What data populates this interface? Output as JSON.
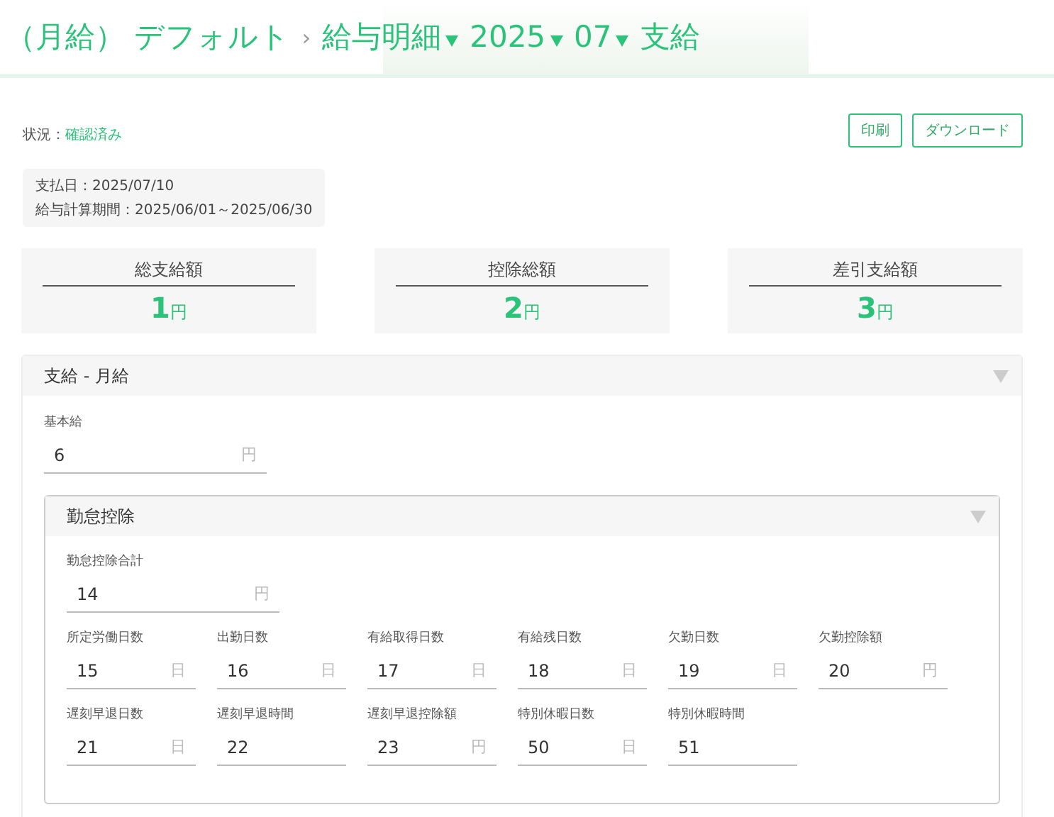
{
  "breadcrumb": [
    {
      "label": "（月給） デフォルト",
      "dropdown": false
    },
    {
      "label": "給与明細",
      "dropdown": true
    },
    {
      "label": "2025",
      "dropdown": true
    },
    {
      "label": "07",
      "dropdown": true
    },
    {
      "label": "支給",
      "dropdown": false
    }
  ],
  "breadcrumb_separator": "›",
  "status": {
    "label": "状況：",
    "value": "確認済み"
  },
  "buttons": [
    "印刷",
    "ダウンロード"
  ],
  "info": [
    "支払日：2025/07/10",
    "給与計算期間：2025/06/01～2025/06/30"
  ],
  "summary": [
    {
      "label": "総支給額",
      "amount": "1",
      "unit": "円"
    },
    {
      "label": "控除総額",
      "amount": "2",
      "unit": "円"
    },
    {
      "label": "差引支給額",
      "amount": "3",
      "unit": "円"
    }
  ],
  "panel": {
    "title": "支給 - 月給",
    "expanded": true,
    "fields": [
      {
        "label": "基本給",
        "value": "6",
        "unit": "円"
      }
    ],
    "subpanel": {
      "title": "勤怠控除",
      "expanded": true,
      "total": {
        "label": "勤怠控除合計",
        "value": "14",
        "unit": "円"
      },
      "rows": [
        [
          {
            "label": "所定労働日数",
            "value": "15",
            "unit": "日"
          },
          {
            "label": "出勤日数",
            "value": "16",
            "unit": "日"
          },
          {
            "label": "有給取得日数",
            "value": "17",
            "unit": "日"
          },
          {
            "label": "有給残日数",
            "value": "18",
            "unit": "日"
          },
          {
            "label": "欠勤日数",
            "value": "19",
            "unit": "日"
          },
          {
            "label": "欠勤控除額",
            "value": "20",
            "unit": "円"
          }
        ],
        [
          {
            "label": "遅刻早退日数",
            "value": "21",
            "unit": "日"
          },
          {
            "label": "遅刻早退時間",
            "value": "22"
          },
          {
            "label": "遅刻早退控除額",
            "value": "23",
            "unit": "円"
          },
          {
            "label": "特別休暇日数",
            "value": "50",
            "unit": "日"
          },
          {
            "label": "特別休暇時間",
            "value": "51"
          }
        ]
      ]
    }
  }
}
